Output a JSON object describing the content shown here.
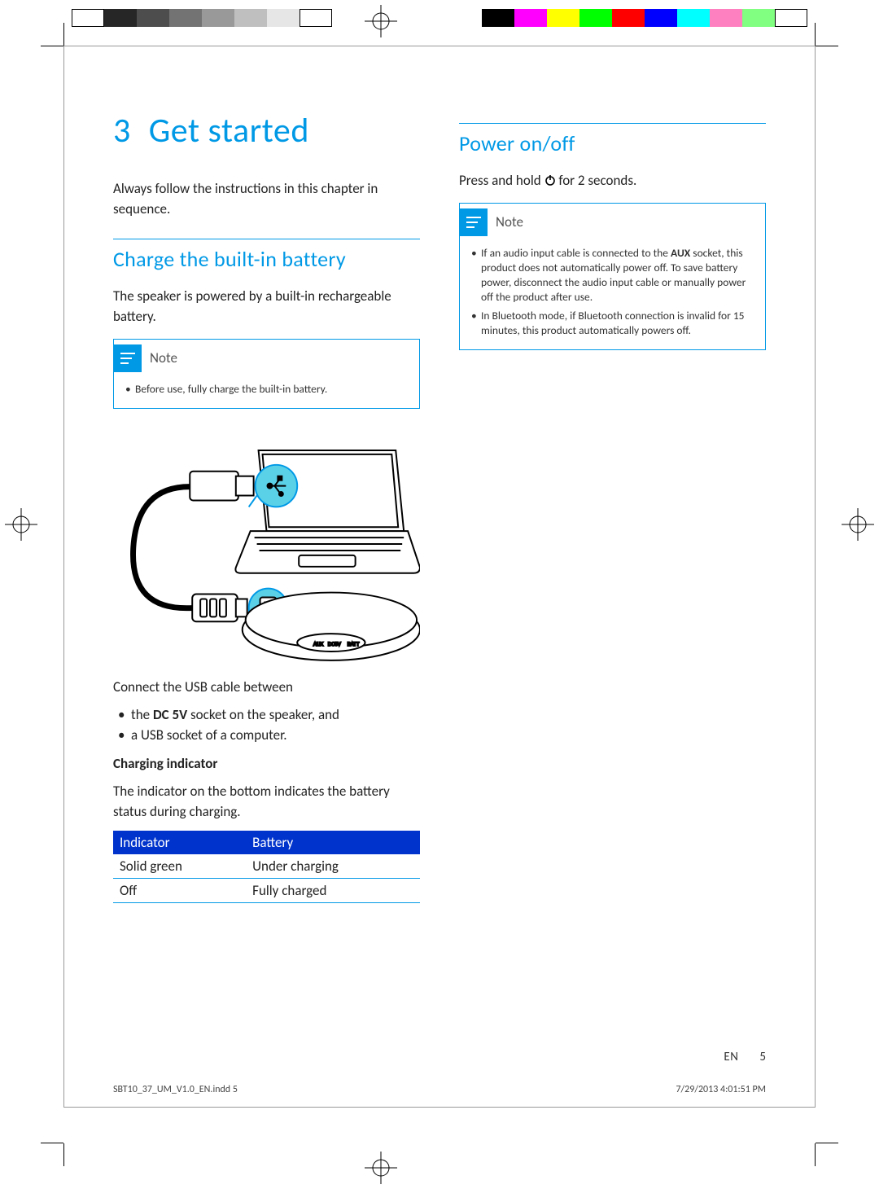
{
  "chapter": {
    "number": "3",
    "title": "Get started"
  },
  "intro": "Always follow the instructions in this chapter in sequence.",
  "section_charge": {
    "heading": "Charge the built-in battery",
    "intro": "The speaker is powered by a built-in rechargeable battery.",
    "note_title": "Note",
    "note_items": [
      "Before use, fully charge the built-in battery."
    ],
    "connect_lead": "Connect the USB cable between",
    "connect_items": [
      "the <strong>DC 5V</strong> socket on the speaker, and",
      "a USB socket of a computer."
    ],
    "indicator_head": "Charging indicator",
    "indicator_body": "The indicator on the bottom indicates the battery status during charging.",
    "table": {
      "headers": [
        "Indicator",
        "Battery"
      ],
      "rows": [
        [
          "Solid green",
          "Under charging"
        ],
        [
          "Off",
          "Fully charged"
        ]
      ]
    }
  },
  "section_power": {
    "heading": "Power on/off",
    "instr_pre": "Press and hold ",
    "instr_post": " for 2 seconds.",
    "note_title": "Note",
    "note_items": [
      "If an audio input cable is connected to the <strong>AUX</strong> socket, this product does not automatically power off. To save battery power, disconnect the audio input cable or manually power off the product after use.",
      "In Bluetooth mode, if Bluetooth connection is invalid for 15 minutes, this product automatically powers off."
    ]
  },
  "footer": {
    "lang": "EN",
    "page": "5"
  },
  "imprint": {
    "file": "SBT10_37_UM_V1.0_EN.indd   5",
    "stamp": "7/29/2013   4:01:51 PM"
  }
}
